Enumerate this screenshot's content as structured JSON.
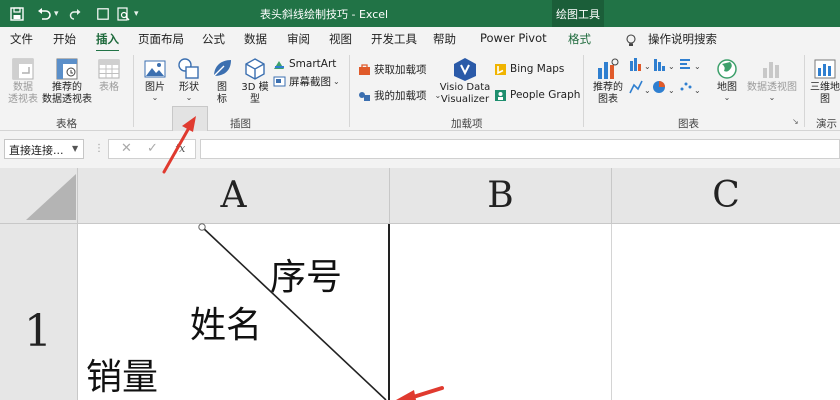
{
  "titlebar": {
    "title": "表头斜线绘制技巧 - Excel",
    "context_tab": "绘图工具"
  },
  "tabs": [
    {
      "label": "文件"
    },
    {
      "label": "开始"
    },
    {
      "label": "插入"
    },
    {
      "label": "页面布局"
    },
    {
      "label": "公式"
    },
    {
      "label": "数据"
    },
    {
      "label": "审阅"
    },
    {
      "label": "视图"
    },
    {
      "label": "开发工具"
    },
    {
      "label": "帮助"
    },
    {
      "label": "Power Pivot"
    },
    {
      "label": "格式"
    }
  ],
  "active_tab": "插入",
  "tell_me": "操作说明搜索",
  "ribbon": {
    "tables": {
      "pivot_table": "数据\n透视表",
      "recommended_pivot": "推荐的\n数据透视表",
      "table": "表格",
      "group_label": "表格"
    },
    "illustrations": {
      "pictures": "图片",
      "shapes": "形状",
      "icons": "图\n标",
      "models_3d": "3D 模\n型",
      "smartart": "SmartArt",
      "screenshot": "屏幕截图",
      "group_label": "插图"
    },
    "addins": {
      "get_addins": "获取加载项",
      "my_addins": "我的加载项",
      "visio": "Visio Data\nVisualizer",
      "bing_maps": "Bing Maps",
      "people_graph": "People Graph",
      "group_label": "加载项"
    },
    "charts": {
      "recommended": "推荐的\n图表",
      "maps": "地图",
      "pivot_chart": "数据透视图",
      "group_label": "图表"
    },
    "tours": {
      "map_3d": "三维地\n图",
      "group_label": "演示"
    }
  },
  "formula_bar": {
    "name_box": "直接连接...",
    "formula": "",
    "fx": "fx"
  },
  "sheet": {
    "columns": [
      "A",
      "B",
      "C"
    ],
    "rows": [
      "1"
    ],
    "cell_a1_labels": {
      "top": "序号",
      "middle": "姓名",
      "bottom": "销量"
    }
  },
  "colors": {
    "excel_green": "#217346",
    "arrow_red": "#e03a2f",
    "ribbon_bg": "#f3f3f3",
    "header_bg": "#e6e6e6"
  }
}
